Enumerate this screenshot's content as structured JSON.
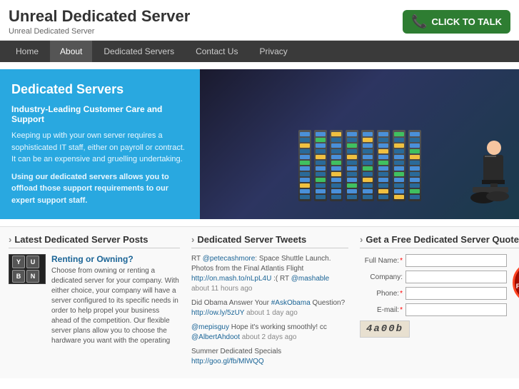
{
  "site": {
    "title": "Unreal Dedicated Server",
    "subtitle": "Unreal Dedicated Server"
  },
  "click_to_talk": {
    "label": "CLICK TO TALK",
    "icon": "📞"
  },
  "nav": {
    "items": [
      {
        "label": "Home",
        "active": false
      },
      {
        "label": "About",
        "active": true
      },
      {
        "label": "Dedicated Servers",
        "active": false
      },
      {
        "label": "Contact Us",
        "active": false
      },
      {
        "label": "Privacy",
        "active": false
      }
    ]
  },
  "hero": {
    "title": "Dedicated Servers",
    "tagline": "Industry-Leading Customer Care and Support",
    "body1": "Keeping up with your own server requires a sophisticated IT staff, either on payroll or contract. It can be an expensive and gruelling undertaking.",
    "body2": "Using our dedicated servers allows you to offload those support requirements to our expert support staff."
  },
  "posts": {
    "heading": "Latest Dedicated Server Posts",
    "items": [
      {
        "title": "Renting or Owning?",
        "body": "Choose from owning or renting a dedicated server for your company. With either choice, your company will have a server configured to its specific needs in order to help propel your business ahead of the competition. Our flexible server plans allow you to choose the hardware you want with the operating"
      }
    ]
  },
  "tweets": {
    "heading": "Dedicated Server Tweets",
    "items": [
      {
        "prefix": "RT ",
        "handle": "@petecashmore",
        "text": ": Space Shuttle Launch. Photos from the Final Atlantis Flight ",
        "link": "http://on.mash.to/nLpL4U",
        "suffix": " :( RT ",
        "handle2": "@mashable",
        "time": "about 11 hours ago"
      },
      {
        "prefix": "Did Obama Answer Your ",
        "hashtag": "#AskObama",
        "text": " Question? ",
        "link": "http://ow.ly/5zUY",
        "time": "about 1 day ago"
      },
      {
        "handle": "@mepisguy",
        "text": " Hope it's working smoothly! cc ",
        "handle2": "@AlbertAhdoot",
        "time": "about 2 days ago"
      },
      {
        "prefix": "Summer Dedicated Specials ",
        "link": "http://goo.gl/fb/MlWQQ"
      }
    ]
  },
  "quote": {
    "heading": "Get a Free Dedicated Server Quote Now!",
    "fields": [
      {
        "label": "Full Name:",
        "required": true,
        "name": "fullname"
      },
      {
        "label": "Company:",
        "required": false,
        "name": "company"
      },
      {
        "label": "Phone:",
        "required": true,
        "name": "phone"
      },
      {
        "label": "E-mail:",
        "required": true,
        "name": "email"
      }
    ],
    "captcha_text": "4a00b",
    "button_label": "Request a Free Quote!"
  },
  "keys": [
    "Y",
    "U",
    "B",
    "N"
  ]
}
